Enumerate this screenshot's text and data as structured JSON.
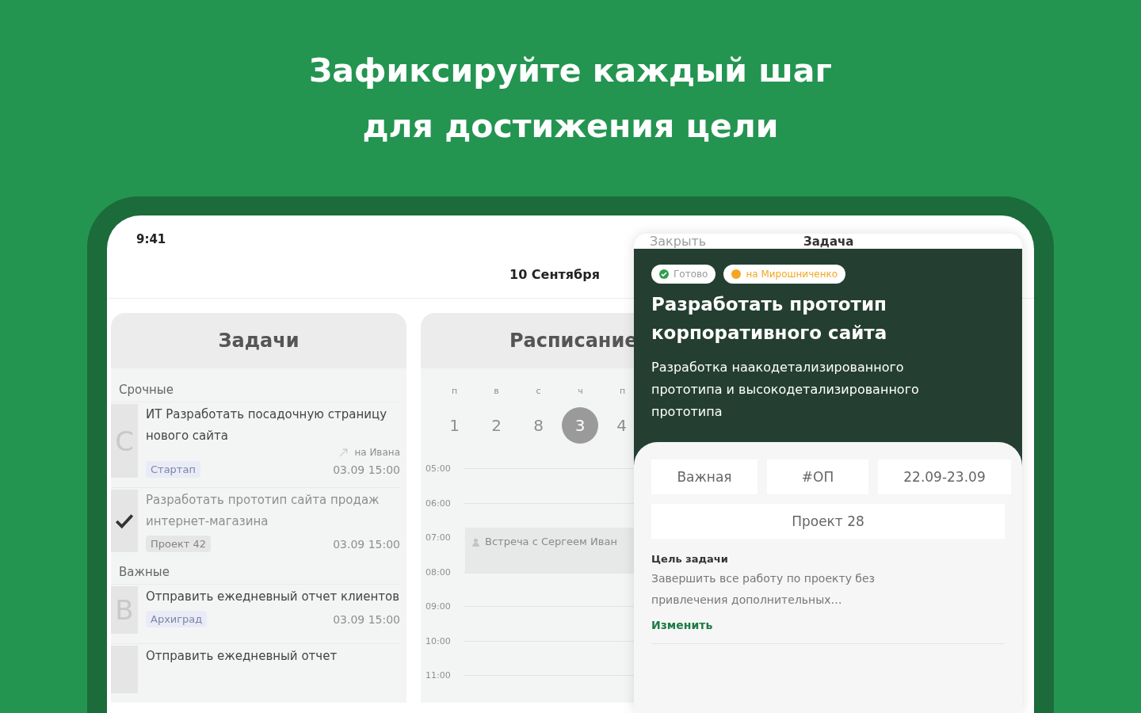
{
  "headline": [
    "Зафиксируйте каждый шаг",
    "для достижения цели"
  ],
  "status_time": "9:41",
  "date": "10 Сентября",
  "tasks_panel": {
    "title": "Задачи",
    "groups": [
      {
        "label": "Срочные",
        "tasks": [
          {
            "letter": "С",
            "title": "ИТ Разработать посадочную страницу нового сайта",
            "assignee": "на Ивана",
            "tag": "Стартап",
            "time": "03.09  15:00",
            "done": false
          },
          {
            "title": "Разработать прототип сайта продаж интернет-магазина",
            "tag": "Проект 42",
            "time": "03.09  15:00",
            "done": true
          }
        ]
      },
      {
        "label": "Важные",
        "tasks": [
          {
            "letter": "В",
            "title": "Отправить ежедневный отчет клиентов",
            "tag": "Архиград",
            "time": "03.09  15:00",
            "done": false
          },
          {
            "title": "Отправить ежедневный отчет",
            "done": false
          }
        ]
      }
    ]
  },
  "schedule_panel": {
    "title": "Расписание",
    "weekdays": [
      "п",
      "в",
      "с",
      "ч",
      "п"
    ],
    "days": [
      {
        "label": "1",
        "selected": false
      },
      {
        "label": "2",
        "selected": false
      },
      {
        "label": "8",
        "selected": false
      },
      {
        "label": "3",
        "selected": true
      },
      {
        "label": "4",
        "selected": false
      }
    ],
    "hours": [
      "05:00",
      "06:00",
      "07:00",
      "08:00",
      "09:00",
      "10:00",
      "11:00"
    ],
    "event": {
      "title": "Встреча с Сергеем Иван"
    }
  },
  "task_sheet": {
    "close": "Закрыть",
    "title": "Задача",
    "badges": [
      {
        "label": "Готово",
        "kind": "done",
        "color": "#2e9e4f"
      },
      {
        "label": "на Мирошниченко",
        "kind": "assignee",
        "color": "#f5a623"
      }
    ],
    "heading": "Разработать прототип корпоративного сайта",
    "description": "Разработка наакодетализированного прототипа и высокодетализированного прототипа",
    "chips": [
      "Важная",
      "#ОП",
      "22.09-23.09"
    ],
    "project": "Проект 28",
    "goal_label": "Цель задачи",
    "goal_text": "Завершить все работу по проекту без привлечения дополнительных…",
    "edit_link": "Изменить"
  }
}
